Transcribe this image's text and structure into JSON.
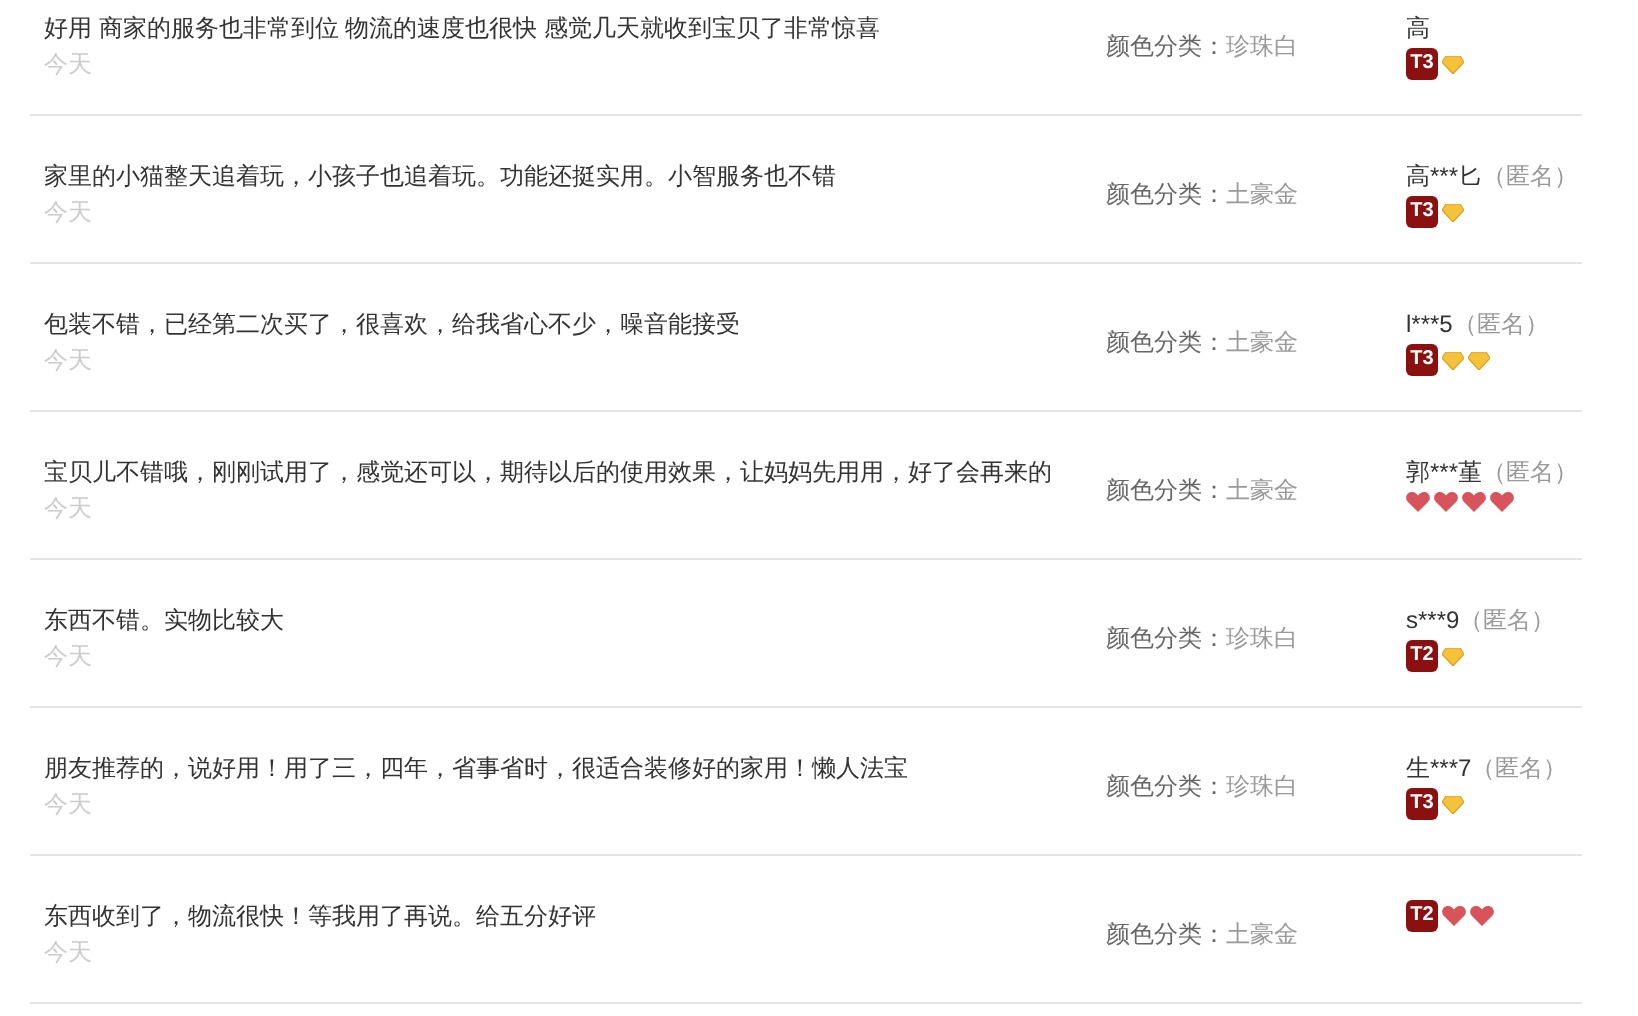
{
  "reviews": [
    {
      "text": "好用 商家的服务也非常到位 物流的速度也很快 感觉几天就收到宝贝了非常惊喜",
      "date": "今天",
      "sku_label": "颜色分类：",
      "sku_value": "珍珠白",
      "user": "高",
      "badge": "T3",
      "gems": [
        {
          "kind": "diamond"
        }
      ]
    },
    {
      "text": "家里的小猫整天追着玩，小孩子也追着玩。功能还挺实用。小智服务也不错",
      "date": "今天",
      "sku_label": "颜色分类：",
      "sku_value": "土豪金",
      "user": "高***匕",
      "anonymous": "（匿名）",
      "badge": "T3",
      "gems": [
        {
          "kind": "diamond"
        }
      ]
    },
    {
      "text": "包装不错，已经第二次买了，很喜欢，给我省心不少，噪音能接受",
      "date": "今天",
      "sku_label": "颜色分类：",
      "sku_value": "土豪金",
      "user": "l***5",
      "anonymous": "（匿名）",
      "badge": "T3",
      "gems": [
        {
          "kind": "diamond"
        },
        {
          "kind": "diamond"
        }
      ]
    },
    {
      "text": "宝贝儿不错哦，刚刚试用了，感觉还可以，期待以后的使用效果，让妈妈先用用，好了会再来的",
      "date": "今天",
      "sku_label": "颜色分类：",
      "sku_value": "土豪金",
      "user": "郭***堇",
      "anonymous": "（匿名）",
      "gems": [
        {
          "kind": "heart"
        },
        {
          "kind": "heart"
        },
        {
          "kind": "heart"
        },
        {
          "kind": "heart"
        }
      ]
    },
    {
      "text": "东西不错。实物比较大",
      "date": "今天",
      "sku_label": "颜色分类：",
      "sku_value": "珍珠白",
      "user": "s***9",
      "anonymous": "（匿名）",
      "badge": "T2",
      "gems": [
        {
          "kind": "diamond"
        }
      ]
    },
    {
      "text": "朋友推荐的，说好用！用了三，四年，省事省时，很适合装修好的家用！懒人法宝",
      "date": "今天",
      "sku_label": "颜色分类：",
      "sku_value": "珍珠白",
      "user": "生***7",
      "anonymous": "（匿名）",
      "badge": "T3",
      "gems": [
        {
          "kind": "diamond"
        }
      ]
    },
    {
      "text": "东西收到了，物流很快！等我用了再说。给五分好评",
      "date": "今天",
      "sku_label": "颜色分类：",
      "sku_value": "土豪金",
      "badge": "T2",
      "gems": [
        {
          "kind": "heart"
        },
        {
          "kind": "heart"
        }
      ]
    }
  ]
}
